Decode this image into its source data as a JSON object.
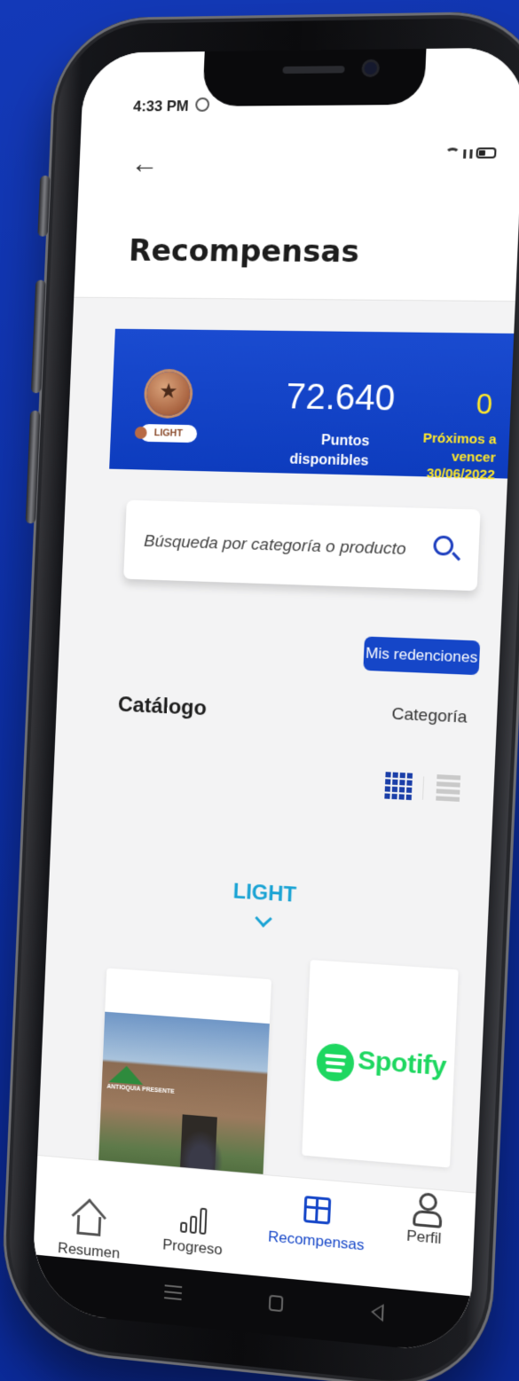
{
  "status": {
    "time": "4:33 PM"
  },
  "header": {
    "title": "Recompensas"
  },
  "points": {
    "level": "LIGHT",
    "available_value": "72.640",
    "available_label_1": "Puntos",
    "available_label_2": "disponibles",
    "expiring_value": "0",
    "expiring_label_1": "Próximos a",
    "expiring_label_2": "vencer",
    "expiring_date": "30/06/2022"
  },
  "search": {
    "placeholder": "Búsqueda por categoría o producto"
  },
  "actions": {
    "redemptions_label": "Mis redenciones"
  },
  "catalog": {
    "title": "Catálogo",
    "category_label": "Categoría",
    "section_title": "LIGHT",
    "cards": [
      {
        "logo_text": "ANTIOQUIA PRESENTE"
      },
      {
        "brand": "Spotify"
      }
    ]
  },
  "bottom_nav": {
    "items": [
      {
        "label": "Resumen",
        "icon": "home-icon"
      },
      {
        "label": "Progreso",
        "icon": "bar-chart-icon"
      },
      {
        "label": "Recompensas",
        "icon": "gift-icon",
        "active": true
      },
      {
        "label": "Perfil",
        "icon": "user-icon"
      }
    ]
  },
  "colors": {
    "primary": "#1546c8",
    "accent_yellow": "#ffe82a",
    "level_teal": "#1aa3d4",
    "spotify_green": "#1ed760",
    "background": "#0c2fa8"
  }
}
